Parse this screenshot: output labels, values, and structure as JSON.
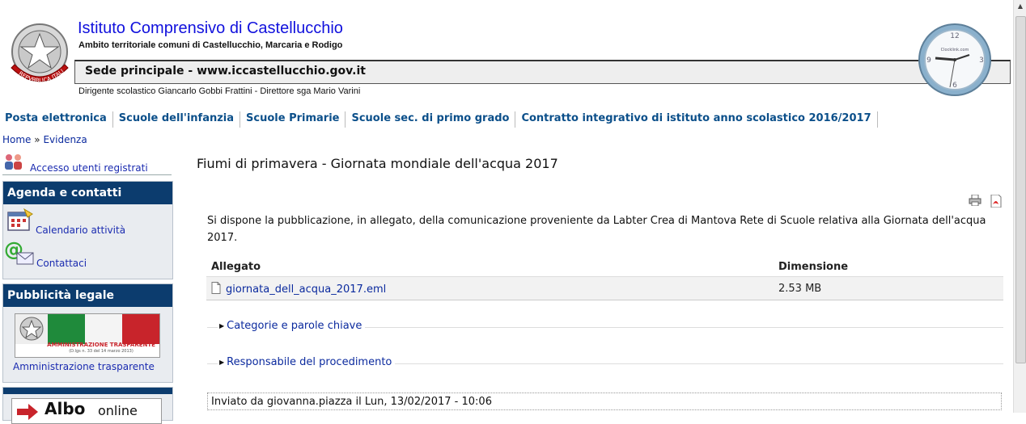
{
  "header": {
    "title": "Istituto Comprensivo di Castellucchio",
    "subtitle": "Ambito territoriale comuni di Castellucchio, Marcaria e Rodigo",
    "sede": "Sede principale - www.iccastellucchio.gov.it",
    "dirigente": "Dirigente scolastico Giancarlo Gobbi Frattini - Direttore sga Mario Varini",
    "emblem_text": "REPVBBLICA ITALIANA",
    "clock_brand": "Clocklink.com",
    "clock_numbers": [
      "12",
      "3",
      "6",
      "9"
    ]
  },
  "nav": {
    "items": [
      {
        "label": "Posta elettronica"
      },
      {
        "label": "Scuole dell'infanzia"
      },
      {
        "label": "Scuole Primarie"
      },
      {
        "label": "Scuole sec. di primo grado"
      },
      {
        "label": "Contratto integrativo di istituto anno scolastico 2016/2017"
      }
    ]
  },
  "breadcrumb": {
    "home": "Home",
    "sep": "»",
    "current": "Evidenza"
  },
  "sidebar": {
    "login_label": "Accesso utenti registrati",
    "agenda_title": "Agenda e contatti",
    "calendario": "Calendario attività",
    "contattaci": "Contattaci",
    "pubblicita_title": "Pubblicità legale",
    "banner_text": "AMMINISTRAZIONE TRASPARENTE",
    "banner_small": "(D.lgs n. 33 del 14 marzo 2013)",
    "amministrazione": "Amministrazione trasparente",
    "albo_text": "Albo",
    "albo_online": "online"
  },
  "main": {
    "title": "Fiumi di primavera - Giornata mondiale dell'acqua 2017",
    "body": "Si dispone la pubblicazione, in allegato, della comunicazione proveniente da Labter Crea di Mantova Rete di Scuole relativa alla Giornata dell'acqua 2017.",
    "table": {
      "col_allegato": "Allegato",
      "col_dimensione": "Dimensione",
      "file_name": "giornata_dell_acqua_2017.eml",
      "file_size": "2.53 MB"
    },
    "categorie": "Categorie e parole chiave",
    "responsabile": "Responsabile del procedimento",
    "submitted": "Inviato da giovanna.piazza il Lun, 13/02/2017 - 10:06"
  },
  "colors": {
    "title_blue": "#1111dd",
    "nav_blue": "#0b4f8a",
    "block_header": "#0c3c6e"
  }
}
